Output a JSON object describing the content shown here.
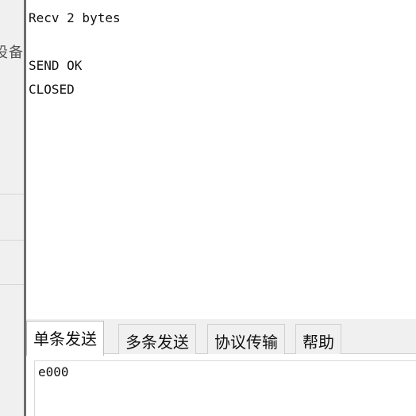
{
  "left_panel": {
    "cropped_label": "设备"
  },
  "receive_log": {
    "lines": [
      "Recv 2 bytes",
      "",
      "SEND OK",
      "CLOSED"
    ]
  },
  "tabs": [
    {
      "label": "单条发送",
      "active": true
    },
    {
      "label": "多条发送",
      "active": false
    },
    {
      "label": "协议传输",
      "active": false
    },
    {
      "label": "帮助",
      "active": false
    }
  ],
  "send_panel": {
    "input_value": "e000"
  }
}
